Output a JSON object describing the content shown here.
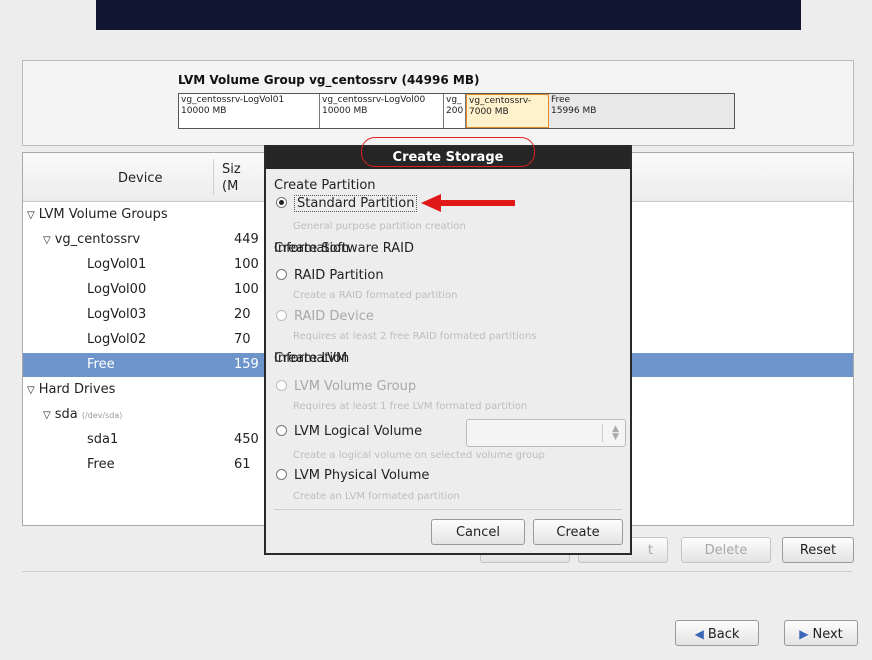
{
  "vg": {
    "title": "LVM Volume Group vg_centossrv (44996 MB)",
    "segments": [
      {
        "name": "vg_centossrv-LogVol01",
        "size": "10000 MB"
      },
      {
        "name": "vg_centossrv-LogVol00",
        "size": "10000 MB"
      },
      {
        "name": "vg_",
        "size": "200"
      },
      {
        "name": "vg_centossrv-",
        "size": "7000 MB"
      },
      {
        "name": "Free",
        "size": "15996 MB"
      }
    ]
  },
  "table": {
    "col_device": "Device",
    "col_size_1": "Siz",
    "col_size_2": "(M"
  },
  "tree": [
    {
      "label": "LVM Volume Groups",
      "size": "",
      "indent": 0,
      "arrow": "▽"
    },
    {
      "label": "vg_centossrv",
      "size": "449",
      "indent": 1,
      "arrow": "▽"
    },
    {
      "label": "LogVol01",
      "size": "100",
      "indent": 2,
      "arrow": ""
    },
    {
      "label": "LogVol00",
      "size": "100",
      "indent": 2,
      "arrow": ""
    },
    {
      "label": "LogVol03",
      "size": "20",
      "indent": 2,
      "arrow": ""
    },
    {
      "label": "LogVol02",
      "size": "70",
      "indent": 2,
      "arrow": ""
    },
    {
      "label": "Free",
      "size": "159",
      "indent": 2,
      "arrow": "",
      "selected": true
    },
    {
      "label": "Hard Drives",
      "size": "",
      "indent": 0,
      "arrow": "▽"
    },
    {
      "label": "sda",
      "path": "(/dev/sda)",
      "size": "",
      "indent": 1,
      "arrow": "▽"
    },
    {
      "label": "sda1",
      "size": "450",
      "indent": 2,
      "arrow": ""
    },
    {
      "label": "Free",
      "size": "61",
      "indent": 2,
      "arrow": ""
    }
  ],
  "buttons": {
    "edit": "t",
    "delete": "Delete",
    "reset": "Reset",
    "back": "Back",
    "next": "Next"
  },
  "dialog": {
    "title": "Create Storage",
    "sec_partition": "Create Partition",
    "standard": "Standard Partition",
    "standard_desc": "General purpose partition creation",
    "sec_raid": "Create Software RAID",
    "info1": "Information",
    "raid_partition": "RAID Partition",
    "raid_partition_desc": "Create a RAID formated partition",
    "raid_device": "RAID Device",
    "raid_device_desc": "Requires at least 2 free RAID formated partitions",
    "sec_lvm": "Create LVM",
    "info2": "Information",
    "lvm_vg": "LVM Volume Group",
    "lvm_vg_desc": "Requires at least 1 free LVM formated partition",
    "lvm_lv": "LVM Logical Volume",
    "lvm_lv_desc": "Create a logical volume on selected volume group",
    "lvm_pv": "LVM Physical Volume",
    "lvm_pv_desc": "Create an LVM formated partition",
    "cancel": "Cancel",
    "create": "Create"
  }
}
